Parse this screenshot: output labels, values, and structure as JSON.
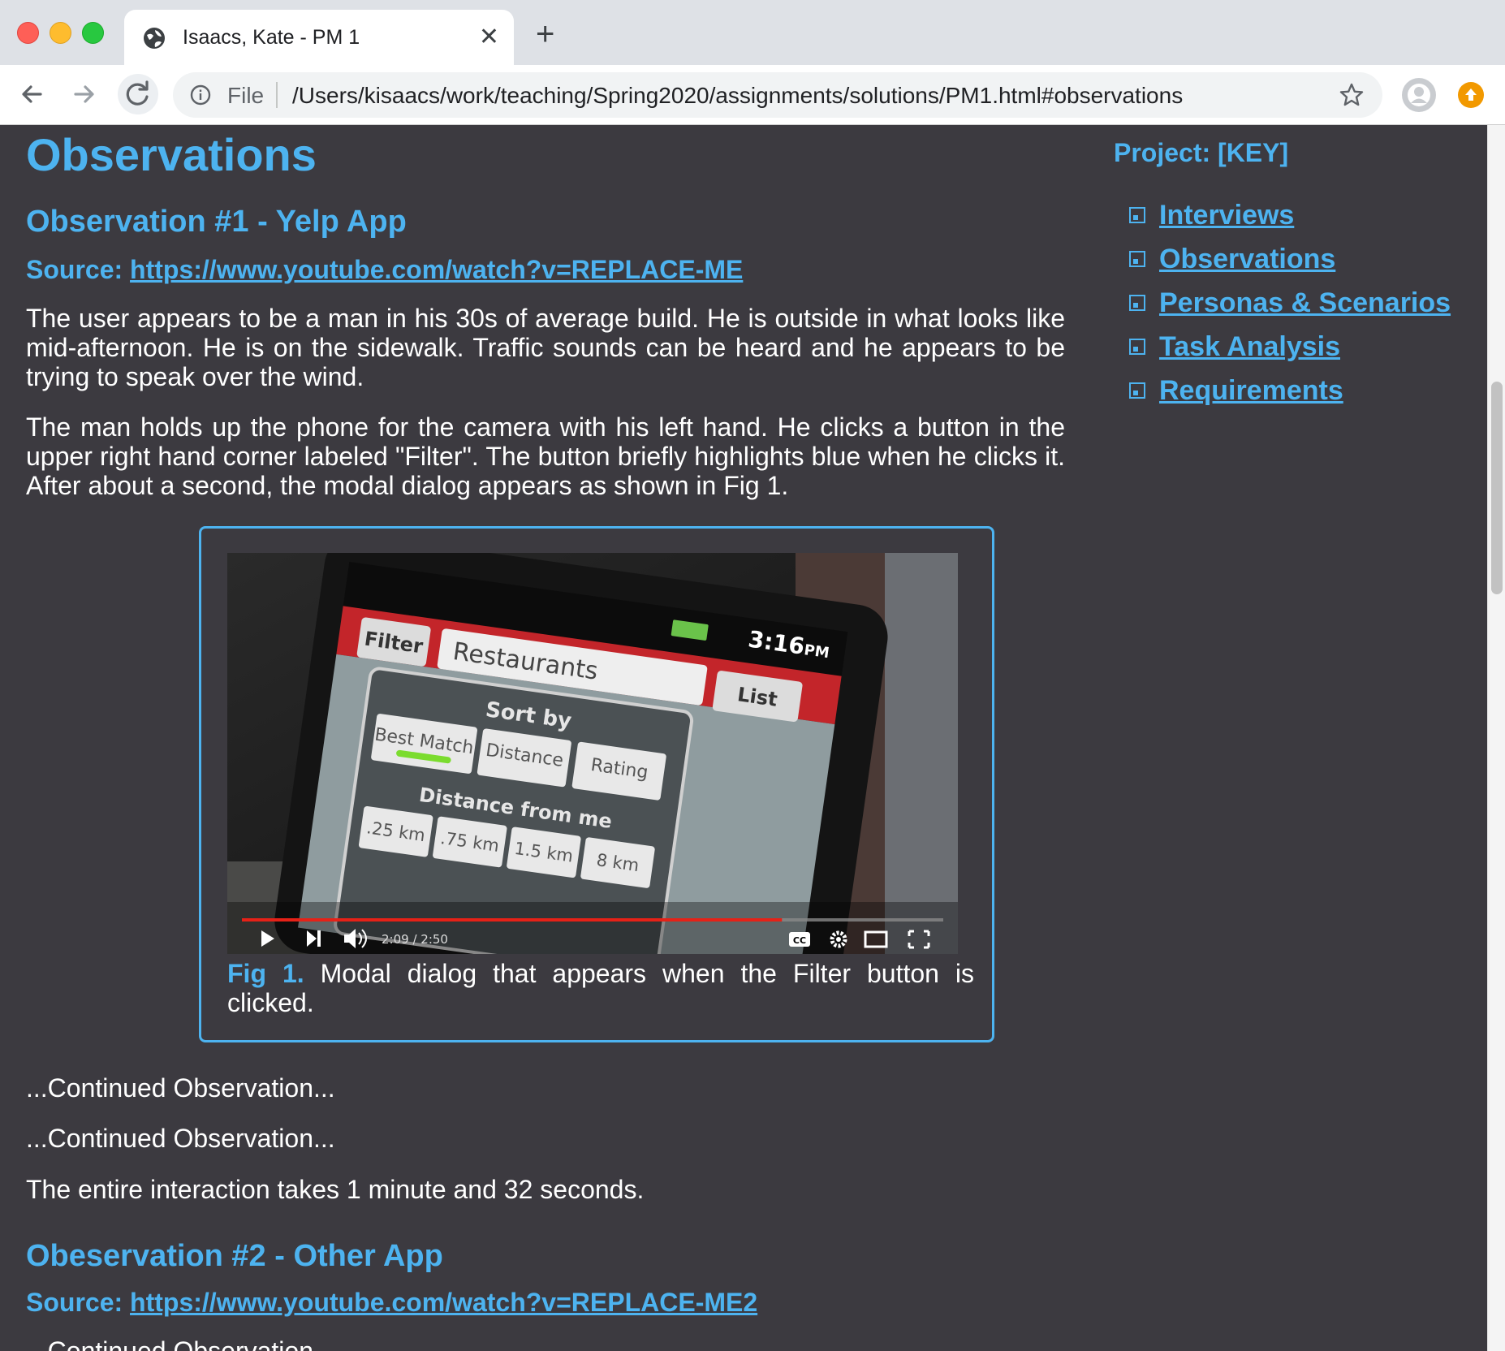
{
  "browser": {
    "tab_title": "Isaacs, Kate - PM 1",
    "tab_close": "✕",
    "new_tab": "+",
    "file_label": "File",
    "url": "/Users/kisaacs/work/teaching/Spring2020/assignments/solutions/PM1.html#observations"
  },
  "page": {
    "heading": "Observations",
    "obs1": {
      "title": "Observation #1 - Yelp App",
      "source_label": "Source:",
      "source_link": "https://www.youtube.com/watch?v=REPLACE-ME",
      "para1": "The user appears to be a man in his 30s of average build. He is outside in what looks like mid-afternoon. He is on the sidewalk. Traffic sounds can be heard and he appears to be trying to speak over the wind.",
      "para2": "The man holds up the phone for the camera with his left hand. He clicks a button in the upper right hand corner labeled \"Filter\". The button briefly highlights blue when he clicks it. After about a second, the modal dialog appears as shown in Fig 1.",
      "figure": {
        "caption_num": "Fig 1.",
        "caption_text": "Modal dialog that appears when the Filter button is clicked.",
        "video": {
          "status_time": "3:16",
          "status_ampm": "PM",
          "filter_btn": "Filter",
          "search_text": "Restaurants",
          "list_btn": "List",
          "sort_by": "Sort by",
          "sort_options": [
            "Best Match",
            "Distance",
            "Rating"
          ],
          "distance_label": "Distance from me",
          "distance_options": [
            ".25 km",
            ".75 km",
            "1.5 km",
            "8 km"
          ],
          "time": "2:09 / 2:50",
          "progress": 0.77,
          "cc": "CC"
        }
      },
      "cont1": "...Continued Observation...",
      "cont2": "...Continued Observation...",
      "total": "The entire interaction takes 1 minute and 32 seconds."
    },
    "obs2": {
      "title": "Obeservation #2 - Other App",
      "source_label": "Source:",
      "source_link": "https://www.youtube.com/watch?v=REPLACE-ME2",
      "cont": "...Continued Observation..."
    }
  },
  "sidebar": {
    "title": "Project: [KEY]",
    "items": [
      "Interviews",
      "Observations",
      "Personas & Scenarios",
      "Task Analysis",
      "Requirements"
    ]
  },
  "colors": {
    "accent": "#4db3f0",
    "page_bg": "#3c3a40",
    "text": "#ffffff"
  }
}
